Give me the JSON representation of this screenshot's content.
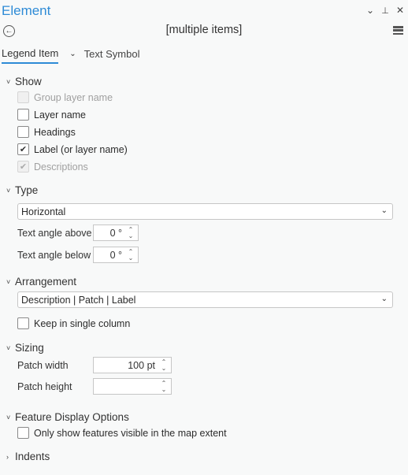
{
  "window": {
    "title": "Element",
    "controls": {
      "dropdown": "⌄",
      "pin": "⊥",
      "close": "✕"
    }
  },
  "header": {
    "subtitle": "[multiple items]",
    "back_icon": "←"
  },
  "tabs": [
    {
      "label": "Legend Item",
      "active": true
    },
    {
      "label": "Text Symbol",
      "active": false
    }
  ],
  "sections": {
    "show": {
      "title": "Show",
      "items": [
        {
          "label": "Group layer name",
          "checked": false,
          "disabled": true
        },
        {
          "label": "Layer name",
          "checked": false,
          "disabled": false
        },
        {
          "label": "Headings",
          "checked": false,
          "disabled": false
        },
        {
          "label": "Label (or layer name)",
          "checked": true,
          "disabled": false
        },
        {
          "label": "Descriptions",
          "checked": true,
          "disabled": true
        }
      ]
    },
    "type": {
      "title": "Type",
      "select_value": "Horizontal",
      "text_angle_above_label": "Text angle above",
      "text_angle_above_value": "0 °",
      "text_angle_below_label": "Text angle below",
      "text_angle_below_value": "0 °"
    },
    "arrangement": {
      "title": "Arrangement",
      "select_value": "Description | Patch | Label",
      "keep_single_column_label": "Keep in single column",
      "keep_single_column_checked": false
    },
    "sizing": {
      "title": "Sizing",
      "patch_width_label": "Patch width",
      "patch_width_value": "100 pt",
      "patch_height_label": "Patch height",
      "patch_height_value": ""
    },
    "feature_display": {
      "title": "Feature Display Options",
      "visible_extent_label": "Only show features visible in the map extent",
      "visible_extent_checked": false
    },
    "indents": {
      "title": "Indents",
      "expanded": false
    }
  },
  "colors": {
    "accent": "#2e8bd6",
    "background": "#f8f9f9"
  }
}
